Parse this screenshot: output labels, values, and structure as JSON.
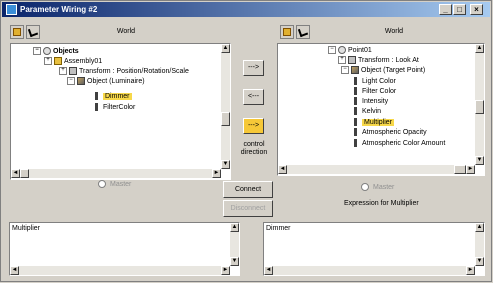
{
  "window": {
    "title": "Parameter Wiring #2",
    "min": "_",
    "max": "□",
    "close": "×"
  },
  "left": {
    "header": "World",
    "tree": [
      {
        "label": "Objects",
        "bold": true,
        "expander": "−",
        "icon": "object-icon",
        "sel": false
      },
      {
        "label": "Assembly01",
        "expander": "+",
        "icon": "group-icon",
        "sel": false
      },
      {
        "label": "Transform : Position/Rotation/Scale",
        "expander": "+",
        "icon": "transform-icon",
        "sel": false
      },
      {
        "label": "Object (Luminaire)",
        "expander": "−",
        "icon": "material-icon",
        "sel": false
      },
      {
        "label": "Dimmer",
        "icon": "param-icon",
        "sel": true
      },
      {
        "label": "FilterColor",
        "icon": "param-icon",
        "sel": false
      }
    ],
    "master_label": "Master",
    "expression": "Multiplier"
  },
  "right": {
    "header": "World",
    "tree": [
      {
        "label": "Point01",
        "expander": "−",
        "icon": "object-icon",
        "sel": false
      },
      {
        "label": "Transform : Look At",
        "expander": "+",
        "icon": "transform-icon",
        "sel": false
      },
      {
        "label": "Object (Target Point)",
        "expander": "−",
        "icon": "material-icon",
        "sel": false
      },
      {
        "label": "Light Color",
        "icon": "param-icon",
        "sel": false
      },
      {
        "label": "Filter Color",
        "icon": "param-icon",
        "sel": false
      },
      {
        "label": "Intensity",
        "icon": "param-icon",
        "sel": false
      },
      {
        "label": "Kelvin",
        "icon": "param-icon",
        "sel": false
      },
      {
        "label": "Multiplier",
        "icon": "param-icon",
        "sel": true
      },
      {
        "label": "Atmospheric Opacity",
        "icon": "param-icon",
        "sel": false
      },
      {
        "label": "Atmospheric Color Amount",
        "icon": "param-icon",
        "sel": false
      }
    ],
    "master_label": "Master",
    "expression_label": "Expression for Multiplier",
    "expression": "Dimmer"
  },
  "center": {
    "arrow_right": "--->",
    "arrow_left": "<---",
    "arrow_both": "--->",
    "control_direction": "control direction",
    "connect": "Connect",
    "disconnect": "Disconnect"
  },
  "colors": {
    "selection": "#f7d84a",
    "titlebar": "#0a246a",
    "face": "#d4d0c8"
  }
}
